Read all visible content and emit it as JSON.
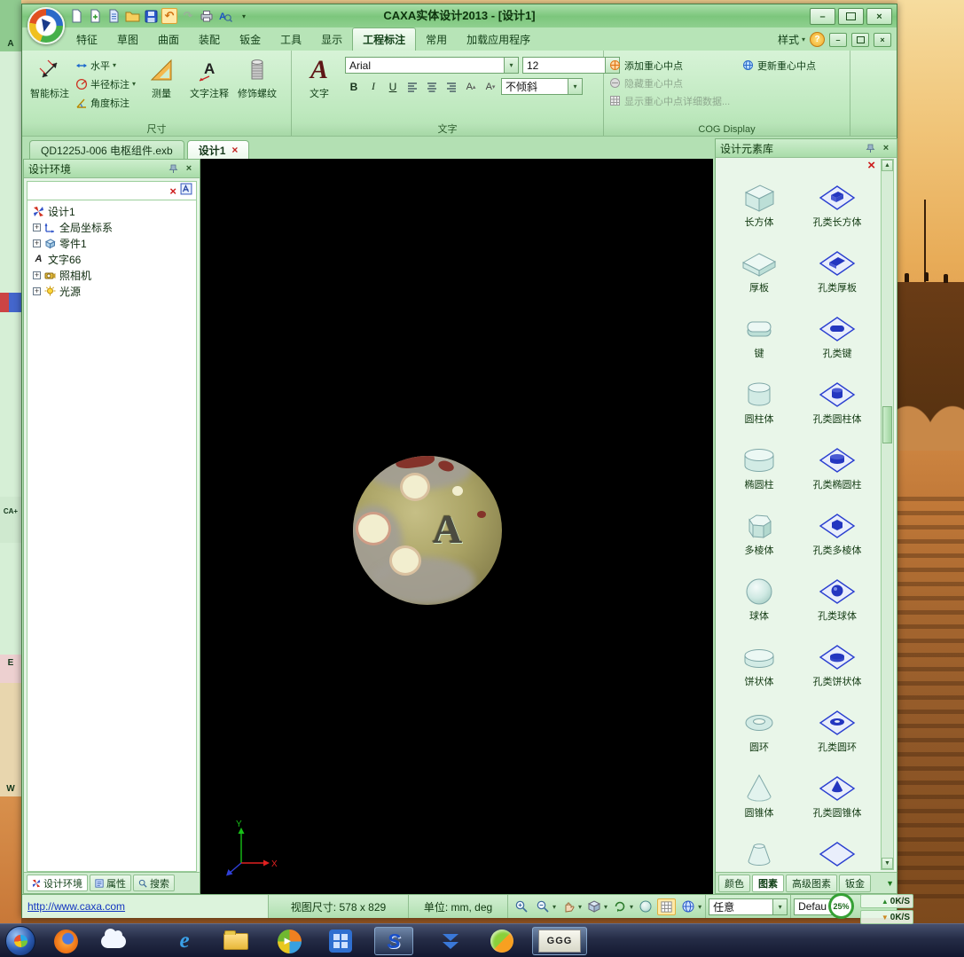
{
  "window": {
    "title": "CAXA实体设计2013 - [设计1]"
  },
  "ribbon": {
    "tabs": [
      {
        "label": "特征"
      },
      {
        "label": "草图"
      },
      {
        "label": "曲面"
      },
      {
        "label": "装配"
      },
      {
        "label": "钣金"
      },
      {
        "label": "工具"
      },
      {
        "label": "显示"
      },
      {
        "label": "工程标注"
      },
      {
        "label": "常用"
      },
      {
        "label": "加载应用程序"
      }
    ],
    "active_tab": "工程标注",
    "style_button": "样式",
    "dimension_group": {
      "label": "尺寸",
      "smart_dim": "智能标注",
      "horizontal": "水平",
      "radius_dim": "半径标注",
      "angle_dim": "角度标注",
      "measure": "测量",
      "text_note": "文字注释",
      "thread": "修饰螺纹"
    },
    "text_group": {
      "label": "文字",
      "text_button": "文字",
      "font_name": "Arial",
      "font_size": "12",
      "bold": "B",
      "italic": "I",
      "underline": "U",
      "slant": "不倾斜"
    },
    "cog_group": {
      "label": "COG Display",
      "add": "添加重心中点",
      "update": "更新重心中点",
      "hide": "隐藏重心中点",
      "detail": "显示重心中点详细数据..."
    }
  },
  "document_tabs": {
    "tab1": "QD1225J-006 电枢组件.exb",
    "tab2": "设计1"
  },
  "design_tree": {
    "title": "设计环境",
    "items": [
      {
        "label": "设计1"
      },
      {
        "label": "全局坐标系"
      },
      {
        "label": "零件1"
      },
      {
        "label": "文字66"
      },
      {
        "label": "照相机"
      },
      {
        "label": "光源"
      }
    ],
    "bottom_tabs": [
      "设计环境",
      "属性",
      "搜索"
    ]
  },
  "canvas": {
    "letter": "A",
    "axis_x": "X",
    "axis_y": "Y"
  },
  "library": {
    "title": "设计元素库",
    "items": [
      "长方体",
      "孔类长方体",
      "厚板",
      "孔类厚板",
      "键",
      "孔类键",
      "圆柱体",
      "孔类圆柱体",
      "椭圆柱",
      "孔类椭圆柱",
      "多棱体",
      "孔类多棱体",
      "球体",
      "孔类球体",
      "饼状体",
      "孔类饼状体",
      "圆环",
      "孔类圆环",
      "圆锥体",
      "孔类圆锥体"
    ],
    "bottom_tabs": [
      "颜色",
      "图素",
      "高级图素",
      "钣金"
    ]
  },
  "status_bar": {
    "url": "http://www.caxa.com",
    "view_size": "视图尺寸: 578 x 829",
    "units": "单位: mm, deg",
    "scale_select": "任意",
    "style_select": "Defau",
    "progress": "25%",
    "upload": "0K/S",
    "download": "0K/S"
  },
  "taskbar": {
    "ggg_label": "GGG"
  },
  "desktop": {
    "left_letters": [
      "A",
      "CA+",
      "E",
      "W"
    ]
  },
  "colors": {
    "chrome_green": "#7cc67c",
    "panel_green": "#b7e4b7",
    "accent_red": "#cc1a1a",
    "hole_blue": "#2436c0",
    "canvas_black": "#000000"
  }
}
